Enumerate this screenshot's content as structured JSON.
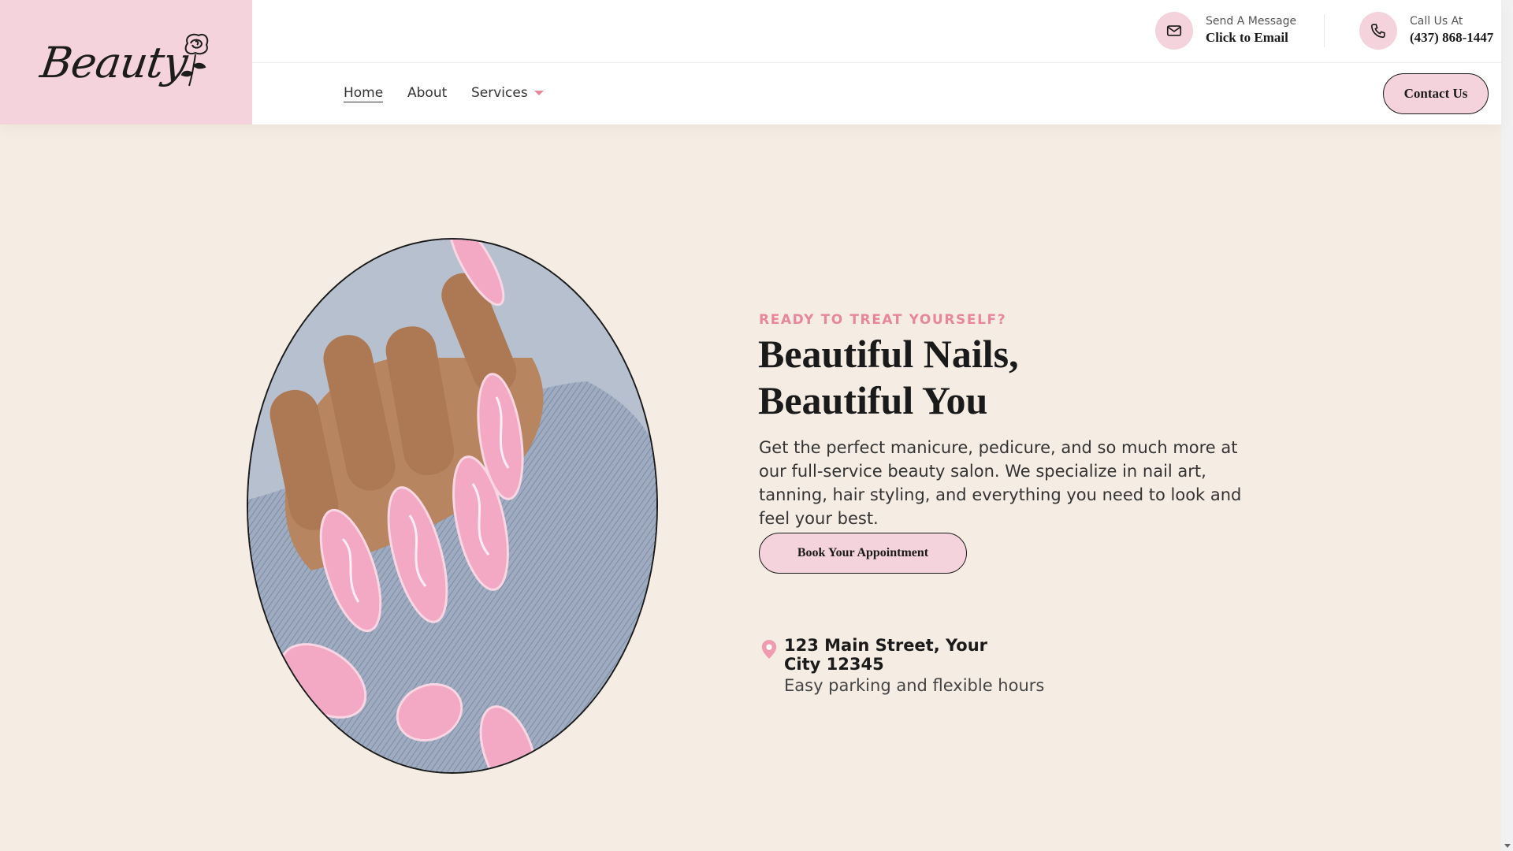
{
  "brand": {
    "logo_text": "Beauty"
  },
  "contacts": {
    "email": {
      "small": "Send A Message",
      "big": "Click to Email",
      "icon": "mail-icon"
    },
    "phone": {
      "small": "Call Us At",
      "big": "(437) 868-1447",
      "icon": "phone-icon"
    }
  },
  "nav": {
    "items": [
      {
        "label": "Home",
        "active": true
      },
      {
        "label": "About",
        "active": false
      },
      {
        "label": "Services",
        "active": false,
        "dropdown": true
      }
    ],
    "cta_label": "Contact Us"
  },
  "hero": {
    "eyebrow": "READY TO TREAT YOURSELF?",
    "headline_line1": "Beautiful Nails,",
    "headline_line2": "Beautiful You",
    "body": "Get the perfect manicure, pedicure, and so much more at our full-service beauty salon. We specialize in nail art, tanning, hair styling, and everything you need to look and feel your best.",
    "button_label": "Book Your Appointment",
    "image_icon": "manicured-hand-photo"
  },
  "location": {
    "icon": "map-pin-icon",
    "address": "123 Main Street, Your City 12345",
    "note": "Easy parking and flexible hours"
  },
  "colors": {
    "accent_pink": "#f4d3dc",
    "eyebrow_pink": "#e8879a",
    "background": "#f5ede4",
    "text": "#1a1a1a"
  }
}
